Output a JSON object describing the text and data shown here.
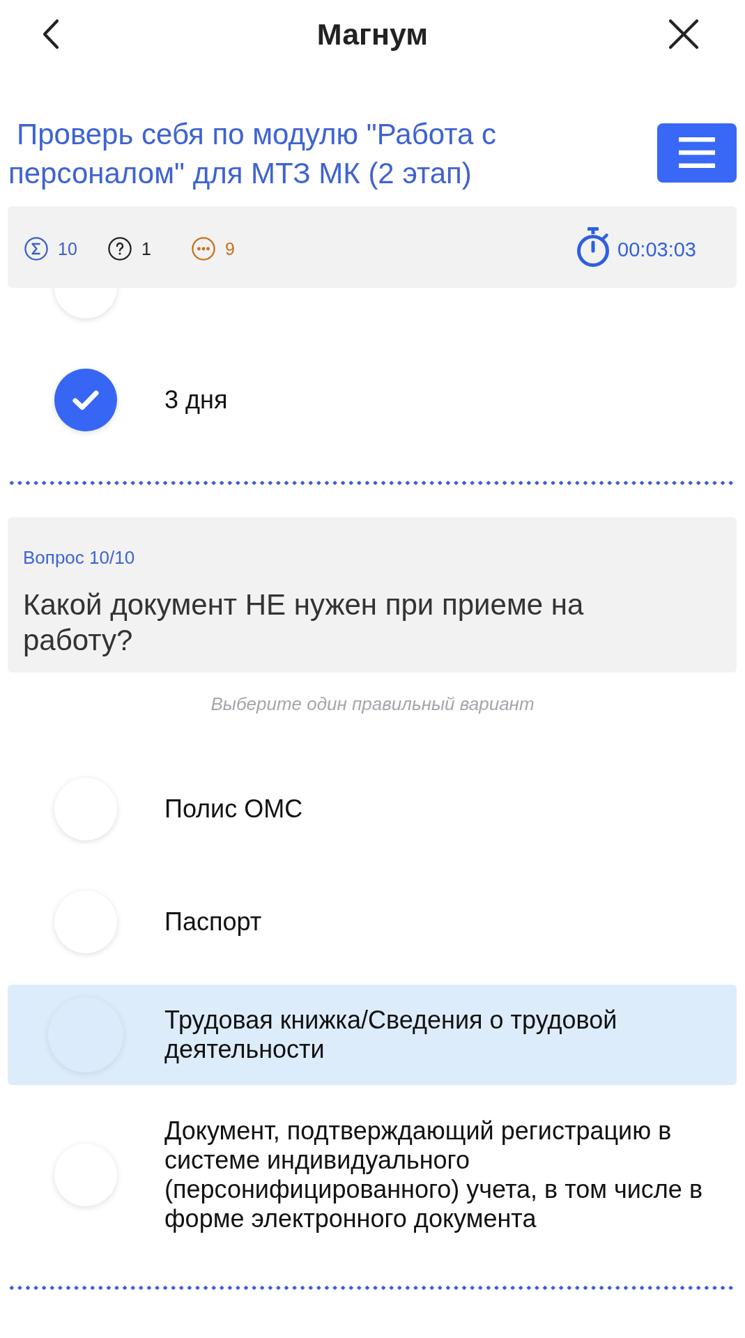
{
  "header": {
    "title": "Магнум"
  },
  "test": {
    "title": "Проверь себя по модулю \"Работа с персоналом\" для МТЗ МК (2 этап)"
  },
  "stats": [
    {
      "kind": "sigma",
      "count": "10",
      "color": "#3b5fcc"
    },
    {
      "kind": "question",
      "count": "1",
      "color": "#222222"
    },
    {
      "kind": "dots",
      "count": "9",
      "color": "#c8701c"
    }
  ],
  "timer": {
    "value": "00:03:03"
  },
  "previous_question": {
    "options": [
      {
        "selected": false
      },
      {
        "text": "3 дня",
        "selected": true
      }
    ]
  },
  "question": {
    "number": "Вопрос 10/10",
    "text": "Какой документ НЕ нужен при приеме на работу?",
    "hint": "Выберите один правильный вариант",
    "options": [
      {
        "text": "Полис ОМС",
        "selected": false,
        "highlighted": false
      },
      {
        "text": "Паспорт",
        "selected": false,
        "highlighted": false
      },
      {
        "text": "Трудовая книжка/Сведения о трудовой деятельности",
        "selected": false,
        "highlighted": true
      },
      {
        "text": "Документ, подтверждающий регистрацию в системе индивидуального (персонифицированного) учета, в том числе в форме электронного документа",
        "selected": false,
        "highlighted": false
      }
    ]
  }
}
